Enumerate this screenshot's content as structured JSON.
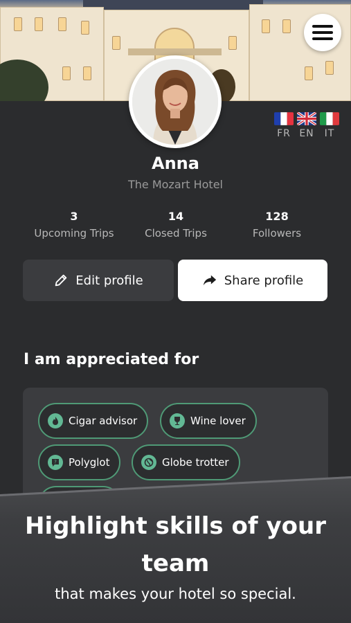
{
  "profile": {
    "name": "Anna",
    "hotel": "The Mozart Hotel"
  },
  "languages": [
    {
      "code": "FR",
      "flag": "france-flag-icon"
    },
    {
      "code": "EN",
      "flag": "uk-flag-icon"
    },
    {
      "code": "IT",
      "flag": "italy-flag-icon"
    }
  ],
  "stats": [
    {
      "value": "3",
      "label": "Upcoming Trips"
    },
    {
      "value": "14",
      "label": "Closed Trips"
    },
    {
      "value": "128",
      "label": "Followers"
    }
  ],
  "actions": {
    "edit_label": "Edit profile",
    "edit_icon": "pencil-icon",
    "share_label": "Share profile",
    "share_icon": "share-arrow-icon"
  },
  "appreciation": {
    "title": "I am appreciated for",
    "tags": [
      {
        "label": "Cigar advisor",
        "icon": "flame-icon"
      },
      {
        "label": "Wine lover",
        "icon": "wine-glass-icon"
      },
      {
        "label": "Polyglot",
        "icon": "speech-bubble-icon"
      },
      {
        "label": "Globe trotter",
        "icon": "globe-icon"
      }
    ]
  },
  "promo": {
    "headline": "Highlight skills of your team",
    "subline": "that makes your hotel so special."
  },
  "colors": {
    "background": "#2b2c2e",
    "card": "#3b3c3f",
    "accent": "#4f9a76",
    "icon_accent": "#62b894"
  }
}
